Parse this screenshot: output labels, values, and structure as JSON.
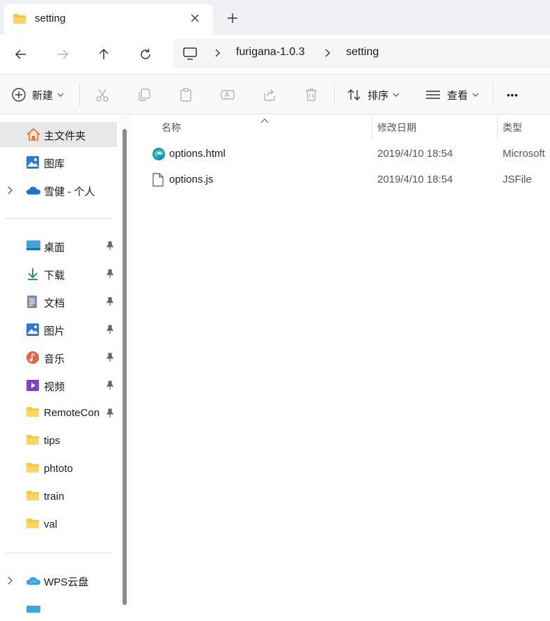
{
  "window": {
    "tab_title": "setting",
    "new_tab_symbol": "+"
  },
  "address": {
    "crumbs": [
      "furigana-1.0.3",
      "setting"
    ]
  },
  "commands": {
    "new_label": "新建",
    "sort_label": "排序",
    "view_label": "查看",
    "more_symbol": "•••"
  },
  "sidebar": {
    "top": [
      {
        "label": "主文件夹",
        "icon": "home-icon"
      },
      {
        "label": "图库",
        "icon": "gallery-icon"
      },
      {
        "label": "雪健 - 个人",
        "icon": "onedrive-icon"
      }
    ],
    "quick": [
      {
        "label": "桌面",
        "icon": "desktop-icon"
      },
      {
        "label": "下载",
        "icon": "download-icon"
      },
      {
        "label": "文档",
        "icon": "documents-icon"
      },
      {
        "label": "图片",
        "icon": "pictures-icon"
      },
      {
        "label": "音乐",
        "icon": "music-icon"
      },
      {
        "label": "视频",
        "icon": "videos-icon"
      },
      {
        "label": "RemoteCon",
        "icon": "folder-icon"
      },
      {
        "label": "tips",
        "icon": "folder-icon"
      },
      {
        "label": "phtoto",
        "icon": "folder-icon"
      },
      {
        "label": "train",
        "icon": "folder-icon"
      },
      {
        "label": "val",
        "icon": "folder-icon"
      }
    ],
    "bottom": [
      {
        "label": "WPS云盘",
        "icon": "wps-cloud-icon"
      }
    ]
  },
  "columns": {
    "name": "名称",
    "modified": "修改日期",
    "type": "类型"
  },
  "files": [
    {
      "name": "options.html",
      "date": "2019/4/10 18:54",
      "type": "Microsoft",
      "icon": "edge-icon"
    },
    {
      "name": "options.js",
      "date": "2019/4/10 18:54",
      "type": "JSFile",
      "icon": "file-icon"
    }
  ],
  "colors": {
    "folder": "#f8c84a",
    "accent": "#0067c0",
    "selected": "#e8e8e8"
  }
}
